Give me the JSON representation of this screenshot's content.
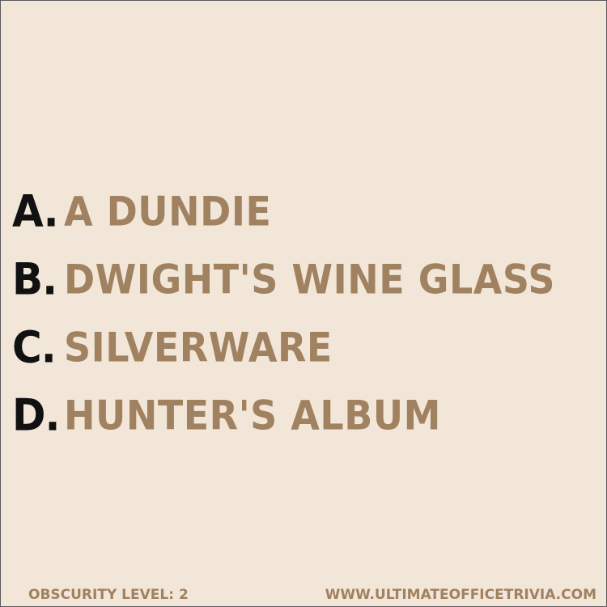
{
  "options": [
    {
      "letter": "A.",
      "text": "A DUNDIE"
    },
    {
      "letter": "B.",
      "text": "DWIGHT'S WINE GLASS"
    },
    {
      "letter": "C.",
      "text": "SILVERWARE"
    },
    {
      "letter": "D.",
      "text": "HUNTER'S ALBUM"
    }
  ],
  "footer": {
    "obscurity": "OBSCURITY LEVEL: 2",
    "website": "WWW.ULTIMATEOFFICETRIVIA.COM"
  },
  "colors": {
    "background": "#f2e6d9",
    "letter": "#111111",
    "answer": "#a08160"
  }
}
